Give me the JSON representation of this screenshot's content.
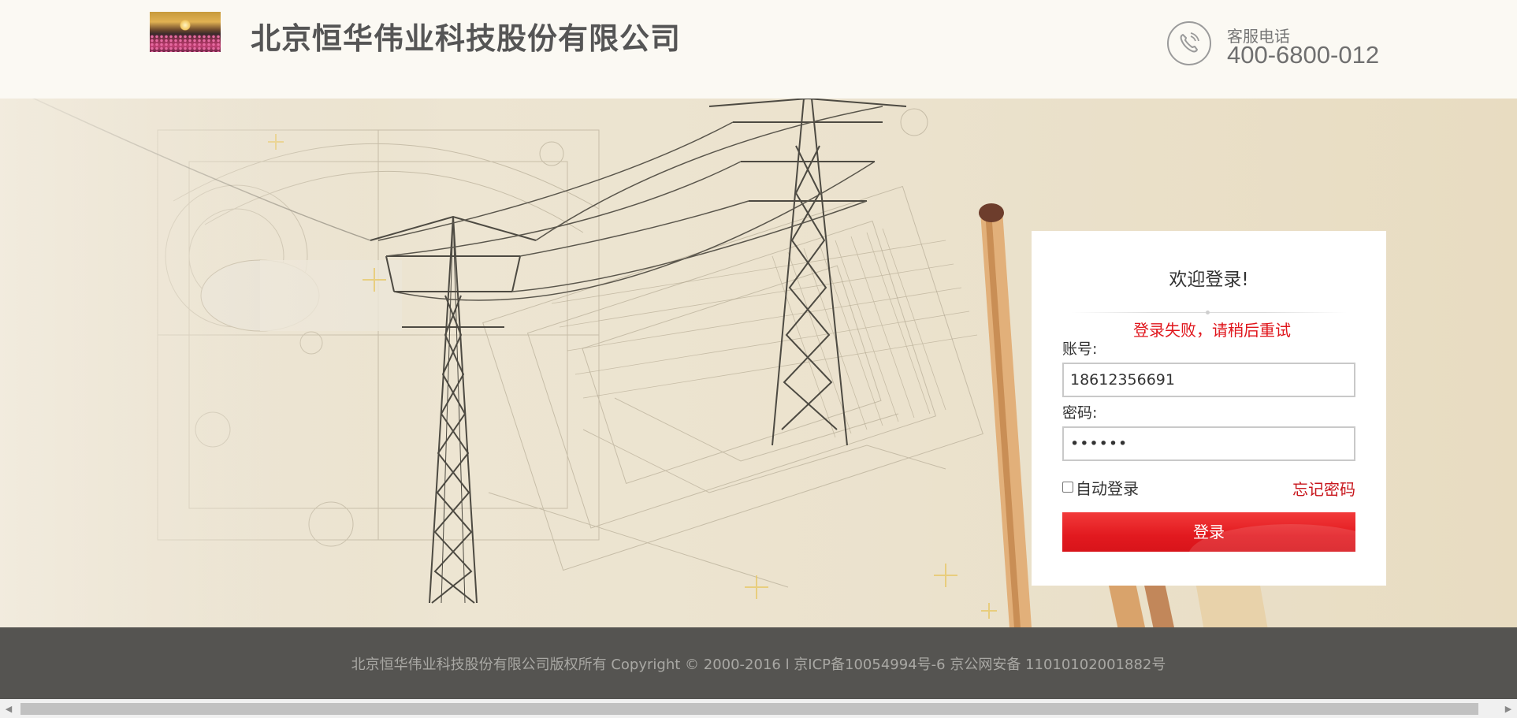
{
  "header": {
    "company_name": "北京恒华伟业科技股份有限公司",
    "service_label": "客服电话",
    "service_phone": "400-6800-012"
  },
  "login": {
    "title": "欢迎登录!",
    "error": "登录失败，请稍后重试",
    "account_label": "账号:",
    "account_value": "18612356691",
    "password_label": "密码:",
    "password_masked": "••••••",
    "remember_label": "自动登录",
    "remember_checked": false,
    "forgot_label": "忘记密码",
    "submit_label": "登录"
  },
  "footer": {
    "copyright": "北京恒华伟业科技股份有限公司版权所有 Copyright © 2000-2016 l 京ICP备10054994号-6 京公网安备 11010102001882号"
  },
  "colors": {
    "accent": "#e2191f",
    "footer_bg": "#555451",
    "header_bg": "#fbf9f3"
  },
  "icons": {
    "phone": "phone-icon",
    "logo": "company-logo"
  }
}
